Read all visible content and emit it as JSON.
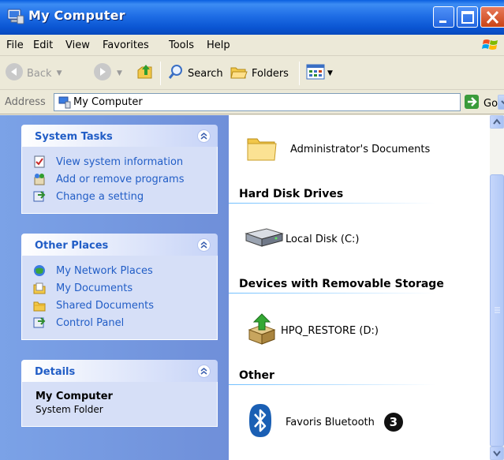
{
  "window": {
    "title": "My Computer"
  },
  "menu": [
    "File",
    "Edit",
    "View",
    "Favorites",
    "Tools",
    "Help"
  ],
  "toolbar": {
    "back": "Back",
    "search": "Search",
    "folders": "Folders"
  },
  "address": {
    "label": "Address",
    "value": "My Computer",
    "go": "Go"
  },
  "left_panels": {
    "system_tasks": {
      "title": "System Tasks",
      "items": [
        "View system information",
        "Add or remove programs",
        "Change a setting"
      ]
    },
    "other_places": {
      "title": "Other Places",
      "items": [
        "My Network Places",
        "My Documents",
        "Shared Documents",
        "Control Panel"
      ]
    },
    "details": {
      "title": "Details",
      "name": "My Computer",
      "type": "System Folder"
    }
  },
  "content": {
    "top_item": "Administrator's Documents",
    "groups": [
      {
        "title": "Hard Disk Drives",
        "item": "Local Disk (C:)"
      },
      {
        "title": "Devices with Removable Storage",
        "item": "HPQ_RESTORE (D:)"
      },
      {
        "title": "Other",
        "item": "Favoris Bluetooth"
      }
    ],
    "callout_number": "3"
  }
}
